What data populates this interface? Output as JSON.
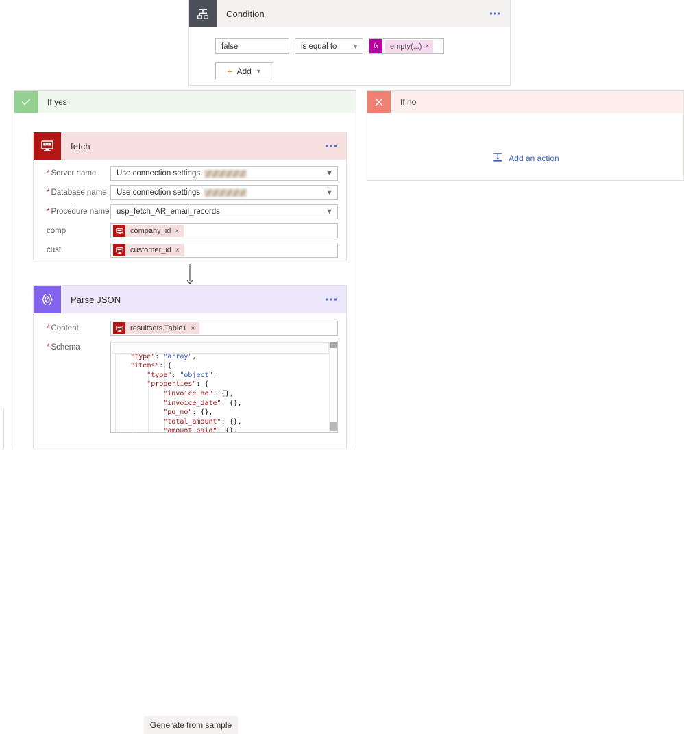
{
  "condition": {
    "title": "Condition",
    "icon": "condition-branch-icon",
    "menu": "more-commands",
    "operand_left": "false",
    "operator": "is equal to",
    "expression_chip": "empty(...)",
    "chip_remove": "×",
    "fx_label": "fx",
    "add_label": "Add"
  },
  "branch_yes": {
    "label": "If yes",
    "icon": "checkmark-icon"
  },
  "branch_no": {
    "label": "If no",
    "icon": "cross-icon",
    "add_action_label": "Add an action",
    "add_action_icon": "insert-step-icon"
  },
  "fetch_action": {
    "title": "fetch",
    "icon": "sql-server-icon",
    "fields": [
      {
        "label": "Server name",
        "required": true,
        "value": "Use connection settings",
        "redacted": true,
        "control": "dropdown"
      },
      {
        "label": "Database name",
        "required": true,
        "value": "Use connection settings",
        "redacted": true,
        "control": "dropdown"
      },
      {
        "label": "Procedure name",
        "required": true,
        "value": "usp_fetch_AR_email_records",
        "redacted": false,
        "control": "dropdown"
      },
      {
        "label": "comp",
        "required": false,
        "token": "company_id",
        "control": "token"
      },
      {
        "label": "cust",
        "required": false,
        "token": "customer_id",
        "control": "token"
      }
    ]
  },
  "parse_json_action": {
    "title": "Parse JSON",
    "icon": "parse-json-icon",
    "content_label": "Content",
    "content_token": "resultsets.Table1",
    "schema_label": "Schema",
    "generate_button": "Generate from sample",
    "schema_lines": [
      [
        {
          "t": "{",
          "c": "p"
        }
      ],
      [
        {
          "t": "    ",
          "c": "p"
        },
        {
          "t": "\"type\"",
          "c": "k"
        },
        {
          "t": ": ",
          "c": "p"
        },
        {
          "t": "\"array\"",
          "c": "v"
        },
        {
          "t": ",",
          "c": "p"
        }
      ],
      [
        {
          "t": "    ",
          "c": "p"
        },
        {
          "t": "\"items\"",
          "c": "k"
        },
        {
          "t": ": {",
          "c": "p"
        }
      ],
      [
        {
          "t": "        ",
          "c": "p"
        },
        {
          "t": "\"type\"",
          "c": "k"
        },
        {
          "t": ": ",
          "c": "p"
        },
        {
          "t": "\"object\"",
          "c": "v"
        },
        {
          "t": ",",
          "c": "p"
        }
      ],
      [
        {
          "t": "        ",
          "c": "p"
        },
        {
          "t": "\"properties\"",
          "c": "k"
        },
        {
          "t": ": {",
          "c": "p"
        }
      ],
      [
        {
          "t": "            ",
          "c": "p"
        },
        {
          "t": "\"invoice_no\"",
          "c": "k"
        },
        {
          "t": ": {},",
          "c": "p"
        }
      ],
      [
        {
          "t": "            ",
          "c": "p"
        },
        {
          "t": "\"invoice_date\"",
          "c": "k"
        },
        {
          "t": ": {},",
          "c": "p"
        }
      ],
      [
        {
          "t": "            ",
          "c": "p"
        },
        {
          "t": "\"po_no\"",
          "c": "k"
        },
        {
          "t": ": {},",
          "c": "p"
        }
      ],
      [
        {
          "t": "            ",
          "c": "p"
        },
        {
          "t": "\"total_amount\"",
          "c": "k"
        },
        {
          "t": ": {},",
          "c": "p"
        }
      ],
      [
        {
          "t": "            ",
          "c": "p"
        },
        {
          "t": "\"amount_paid\"",
          "c": "k"
        },
        {
          "t": ": {},",
          "c": "p"
        }
      ]
    ]
  },
  "colors": {
    "condition_icon_bg": "#4a4f58",
    "yes_accent": "#92d18f",
    "no_accent": "#ef8173",
    "sql_accent": "#b21713",
    "parse_json_accent": "#8163ec",
    "expression_accent": "#b4009e",
    "link_blue": "#3a5fc2"
  }
}
